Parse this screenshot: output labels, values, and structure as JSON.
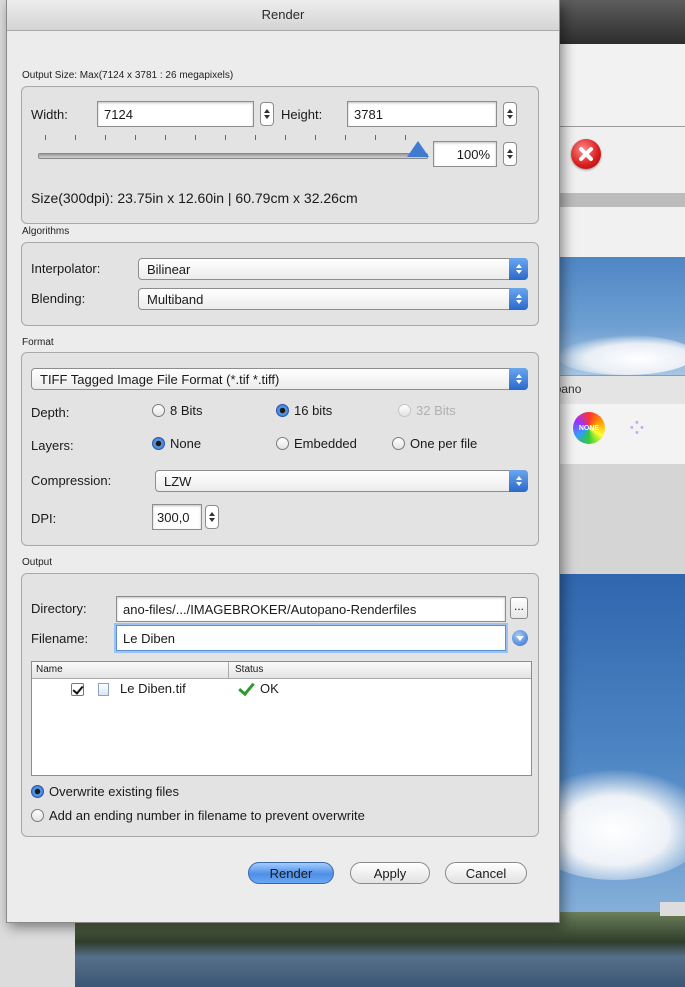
{
  "window": {
    "title": "Render"
  },
  "background": {
    "tab_label": "en.pano",
    "none_badge": "NONE"
  },
  "output_size": {
    "section_label": "Output Size: Max(7124 x 3781 : 26 megapixels)",
    "width_label": "Width:",
    "width_value": "7124",
    "height_label": "Height:",
    "height_value": "3781",
    "zoom_percent": "100%",
    "zoom_fraction": 1.0,
    "size_info": "Size(300dpi): 23.75in x 12.60in | 60.79cm x 32.26cm"
  },
  "algorithms": {
    "section_label": "Algorithms",
    "interpolator_label": "Interpolator:",
    "interpolator_value": "Bilinear",
    "blending_label": "Blending:",
    "blending_value": "Multiband"
  },
  "format": {
    "section_label": "Format",
    "file_format": "TIFF Tagged Image File Format (*.tif *.tiff)",
    "depth_label": "Depth:",
    "depth_options": [
      "8 Bits",
      "16 bits",
      "32 Bits"
    ],
    "depth_selected": "16 bits",
    "layers_label": "Layers:",
    "layers_options": [
      "None",
      "Embedded",
      "One per file"
    ],
    "layers_selected": "None",
    "compression_label": "Compression:",
    "compression_value": "LZW",
    "dpi_label": "DPI:",
    "dpi_value": "300,0"
  },
  "output": {
    "section_label": "Output",
    "directory_label": "Directory:",
    "directory_value": "ano-files/.../IMAGEBROKER/Autopano-Renderfiles",
    "browse_label": "...",
    "filename_label": "Filename:",
    "filename_value": "Le Diben",
    "columns": [
      "Name",
      "Status"
    ],
    "files": [
      {
        "name": "Le Diben.tif",
        "status": "OK"
      }
    ],
    "overwrite_option": "Overwrite existing files",
    "number_option": "Add an ending number in filename to prevent overwrite"
  },
  "buttons": {
    "render": "Render",
    "apply": "Apply",
    "cancel": "Cancel"
  },
  "colors": {
    "accent": "#3f7bd3",
    "ok": "#2e9a2e",
    "close": "#d81c1c"
  }
}
